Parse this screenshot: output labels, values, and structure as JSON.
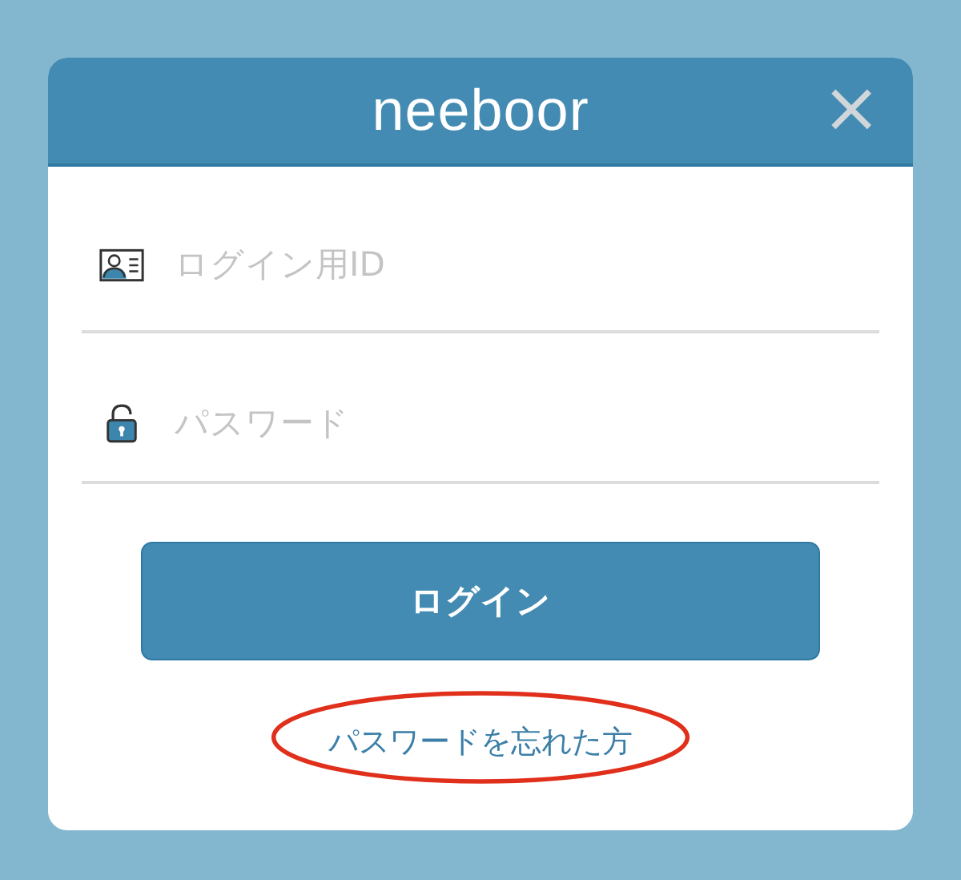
{
  "dialog": {
    "logo": "neeboor",
    "close": "×"
  },
  "fields": [
    {
      "kind": "id",
      "placeholder": "ログイン用ID"
    },
    {
      "kind": "password",
      "placeholder": "パスワード"
    }
  ],
  "login_button": "ログイン",
  "forgot_link": {
    "label": "パスワードを忘れた方",
    "circled": true
  }
}
